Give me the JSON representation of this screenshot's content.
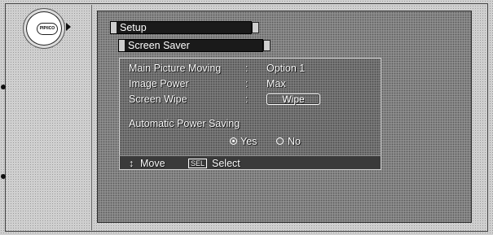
{
  "remote": {
    "button_label": "PIP/ICO"
  },
  "menu": {
    "title": "Setup",
    "submenu": "Screen Saver",
    "rows": [
      {
        "label": "Main Picture Moving",
        "sep": ":",
        "value": "Option 1"
      },
      {
        "label": "Image Power",
        "sep": ":",
        "value": "Max"
      },
      {
        "label": "Screen Wipe",
        "sep": ":",
        "value": "Wipe"
      }
    ],
    "power_saving": {
      "label": "Automatic Power Saving",
      "options": [
        {
          "label": "Yes",
          "selected": true
        },
        {
          "label": "No",
          "selected": false
        }
      ]
    }
  },
  "hints": {
    "move_icon": "↕",
    "move": "Move",
    "select_key": "SEL",
    "select": "Select"
  }
}
